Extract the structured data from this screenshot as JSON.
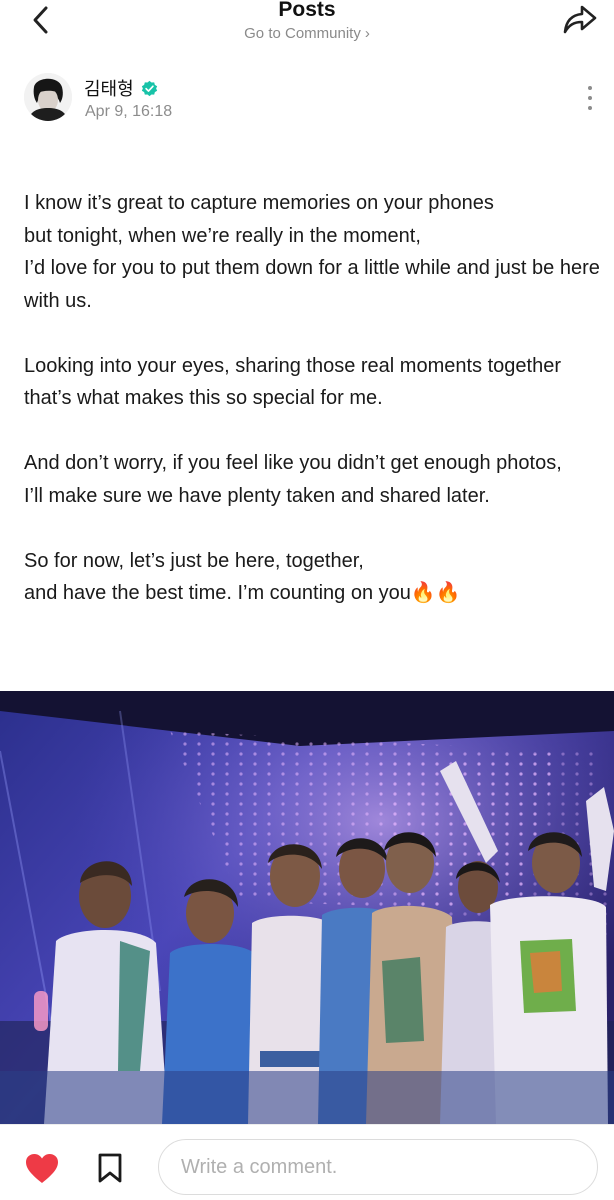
{
  "header": {
    "title": "Posts",
    "community_link": "Go to Community",
    "chevron": "›"
  },
  "author": {
    "name": "김태형",
    "timestamp": "Apr 9, 16:18",
    "verified_icon": "verified-badge-icon",
    "verified_color": "#18c3a8"
  },
  "post": {
    "paragraphs": [
      "I know it’s great to capture memories on your phones\nbut tonight, when we’re really in the moment,\nI’d love for you to put them down for a little while and just be here with us.",
      "Looking into your eyes, sharing those real moments together\nthat’s what makes this so special for me.",
      "And don’t worry, if you feel like you didn’t get enough photos,\nI’ll make sure we have plenty taken and shared later.",
      "So for now, let’s just be here, together,\nand have the best time. I’m counting on you🔥🔥"
    ]
  },
  "footer": {
    "comment_placeholder": "Write a comment.",
    "like_color": "#ee3a46"
  }
}
